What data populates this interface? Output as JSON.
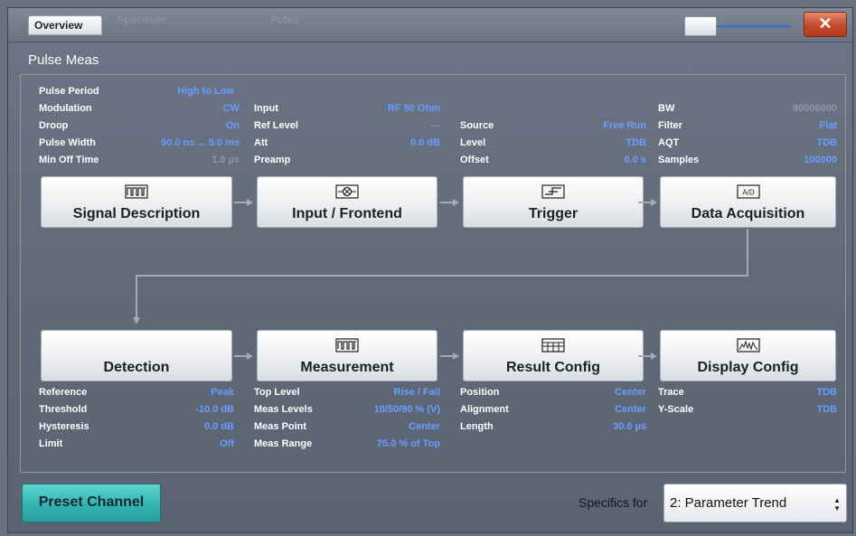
{
  "window": {
    "tab_active": "Overview",
    "tab_ghost_1": "Spectrum",
    "tab_ghost_2": "Pulse",
    "close_label": "✕",
    "title": "Pulse Meas"
  },
  "signal_description": {
    "label": "Signal Description",
    "icon": "pulse-train-icon",
    "params": [
      {
        "label": "Pulse Period",
        "value": "High to Low"
      },
      {
        "label": "Modulation",
        "value": "CW"
      },
      {
        "label": "Droop",
        "value": "On"
      },
      {
        "label": "Pulse Width",
        "value": "50.0 ns ... 5.0 ms"
      },
      {
        "label": "Min Off Time",
        "value": "1.0 µs"
      }
    ]
  },
  "input_frontend": {
    "label": "Input / Frontend",
    "icon": "rf-input-icon",
    "params": [
      {
        "label": "Input",
        "value": "RF 50 Ohm"
      },
      {
        "label": "Ref Level",
        "value": "---"
      },
      {
        "label": "Att",
        "value": "0.0 dB"
      },
      {
        "label": "Preamp",
        "value": ""
      }
    ]
  },
  "trigger": {
    "label": "Trigger",
    "icon": "trigger-edge-icon",
    "params": [
      {
        "label": "Source",
        "value": "Free Run"
      },
      {
        "label": "Level",
        "value": "TDB"
      },
      {
        "label": "Offset",
        "value": "0.0 s"
      }
    ]
  },
  "data_acquisition": {
    "label": "Data Acquisition",
    "icon": "ad-converter-icon",
    "params": [
      {
        "label": "BW",
        "value": "80000000"
      },
      {
        "label": "Filter",
        "value": "Flat"
      },
      {
        "label": "AQT",
        "value": "TDB"
      },
      {
        "label": "Samples",
        "value": "100000"
      }
    ]
  },
  "detection": {
    "label": "Detection",
    "params": [
      {
        "label": "Reference",
        "value": "Peak"
      },
      {
        "label": "Threshold",
        "value": "-10.0 dB"
      },
      {
        "label": "Hysteresis",
        "value": "0.0 dB"
      },
      {
        "label": "Limit",
        "value": "Off"
      }
    ]
  },
  "measurement": {
    "label": "Measurement",
    "icon": "pulse-measure-icon",
    "params": [
      {
        "label": "Top Level",
        "value": "Rise / Fall"
      },
      {
        "label": "Meas Levels",
        "value": "10/50/90 % (V)"
      },
      {
        "label": "Meas Point",
        "value": "Center"
      },
      {
        "label": "Meas Range",
        "value": "75.0 % of Top"
      }
    ]
  },
  "result_config": {
    "label": "Result Config",
    "icon": "table-icon",
    "params": [
      {
        "label": "Position",
        "value": "Center"
      },
      {
        "label": "Alignment",
        "value": "Center"
      },
      {
        "label": "Length",
        "value": "30.0 µs"
      }
    ]
  },
  "display_config": {
    "label": "Display Config",
    "icon": "trace-display-icon",
    "params": [
      {
        "label": "Trace",
        "value": "TDB"
      },
      {
        "label": "Y-Scale",
        "value": "TDB"
      }
    ]
  },
  "footer": {
    "preset_label": "Preset Channel",
    "specifics_label": "Specifics for",
    "specifics_value": "2: Parameter Trend"
  },
  "colors": {
    "value_blue": "#6a9cff",
    "close_red": "#c44a2b",
    "preset_teal": "#34b4b2"
  }
}
